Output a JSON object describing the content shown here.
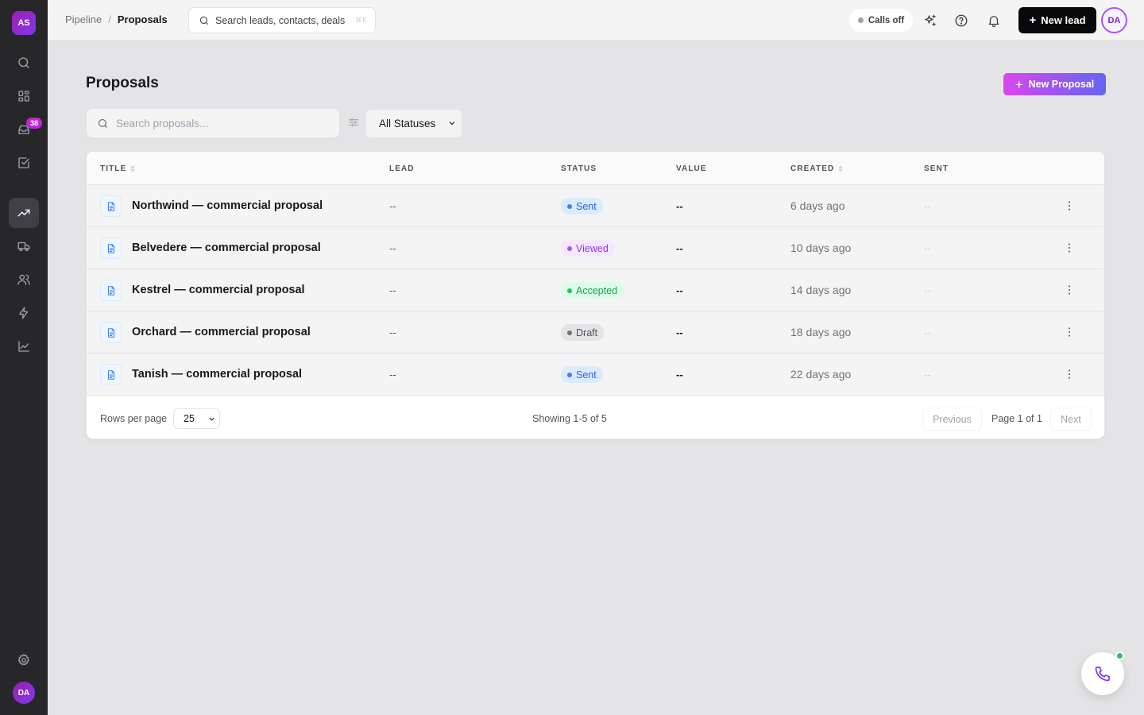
{
  "workspace": {
    "initials": "AS"
  },
  "sidebar": {
    "inbox_badge": "38",
    "user_initials": "DA",
    "active": "pipeline"
  },
  "topbar": {
    "breadcrumb_parent": "Pipeline",
    "breadcrumb_sep": "/",
    "breadcrumb_current": "Proposals",
    "search_placeholder": "Search leads, contacts, deals",
    "search_shortcut": "⌘K",
    "calls_status": "Calls off",
    "new_lead_label": "New lead",
    "user_initials": "DA"
  },
  "page": {
    "title": "Proposals",
    "new_proposal_label": "New Proposal",
    "search_placeholder": "Search proposals...",
    "status_filter": "All Statuses"
  },
  "table": {
    "columns": {
      "title": "TITLE",
      "lead": "LEAD",
      "status": "STATUS",
      "value": "VALUE",
      "created": "CREATED",
      "sent": "SENT"
    },
    "rows": [
      {
        "title": "Northwind — commercial proposal",
        "lead": "--",
        "status": "Sent",
        "value": "--",
        "created": "6 days ago",
        "sent": "--"
      },
      {
        "title": "Belvedere — commercial proposal",
        "lead": "--",
        "status": "Viewed",
        "value": "--",
        "created": "10 days ago",
        "sent": "--"
      },
      {
        "title": "Kestrel — commercial proposal",
        "lead": "--",
        "status": "Accepted",
        "value": "--",
        "created": "14 days ago",
        "sent": "--"
      },
      {
        "title": "Orchard — commercial proposal",
        "lead": "--",
        "status": "Draft",
        "value": "--",
        "created": "18 days ago",
        "sent": "--"
      },
      {
        "title": "Tanish — commercial proposal",
        "lead": "--",
        "status": "Sent",
        "value": "--",
        "created": "22 days ago",
        "sent": "--"
      }
    ],
    "status_colors": {
      "Sent": {
        "bg": "#dbeafe",
        "fg": "#2563eb",
        "dot": "#3b82f6"
      },
      "Viewed": {
        "bg": "#f3e8ff",
        "fg": "#9333ea",
        "dot": "#a855f7"
      },
      "Accepted": {
        "bg": "#dcfce7",
        "fg": "#16a34a",
        "dot": "#22c55e"
      },
      "Draft": {
        "bg": "#e4e4e7",
        "fg": "#52525b",
        "dot": "#71717a"
      }
    }
  },
  "footer": {
    "rows_per_page_label": "Rows per page",
    "rows_per_page_value": "25",
    "showing": "Showing 1-5 of 5",
    "previous": "Previous",
    "page_info": "Page 1 of 1",
    "next": "Next"
  },
  "colors": {
    "accent_gradient_start": "#d946ef",
    "accent_gradient_end": "#6366f1",
    "sidebar_bg": "#27272a",
    "online": "#22c55e"
  }
}
